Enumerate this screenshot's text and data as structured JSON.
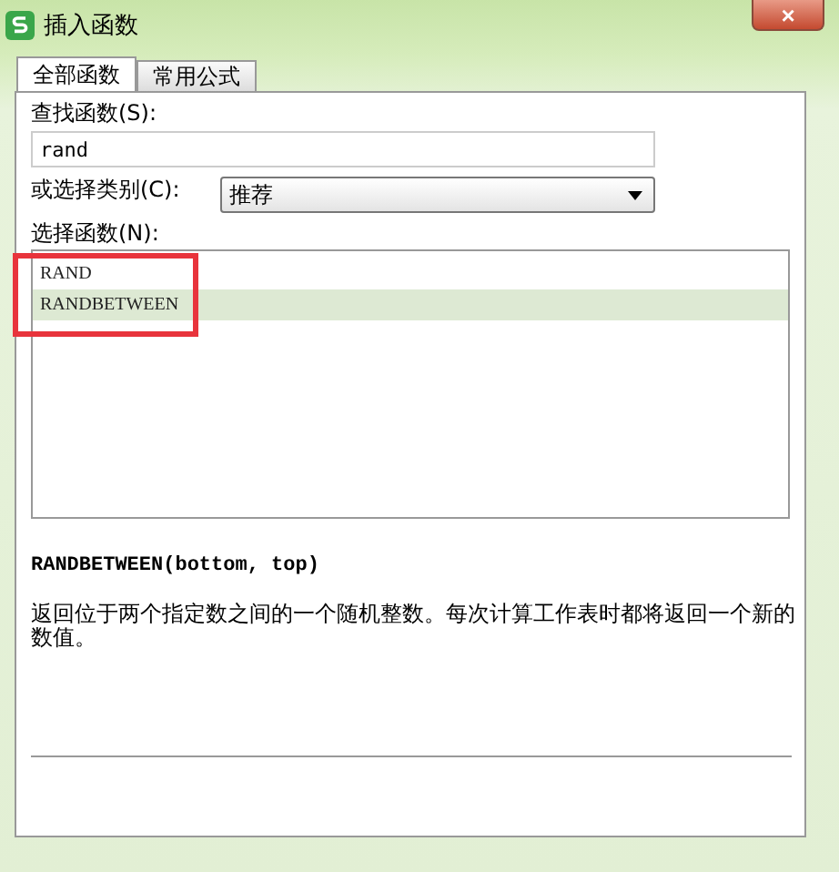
{
  "window": {
    "title": "插入函数",
    "close": "×"
  },
  "tabs": [
    {
      "label": "全部函数",
      "selected": true
    },
    {
      "label": "常用公式",
      "selected": false
    }
  ],
  "search": {
    "label": "查找函数(S):",
    "value": "rand"
  },
  "category": {
    "label": "或选择类别(C):",
    "value": "推荐"
  },
  "functions": {
    "label": "选择函数(N):",
    "items": [
      {
        "name": "RAND",
        "selected": false
      },
      {
        "name": "RANDBETWEEN",
        "selected": true
      }
    ]
  },
  "signature": "RANDBETWEEN(bottom, top)",
  "description": "返回位于两个指定数之间的一个随机整数。每次计算工作表时都将返回一个新的数值。"
}
